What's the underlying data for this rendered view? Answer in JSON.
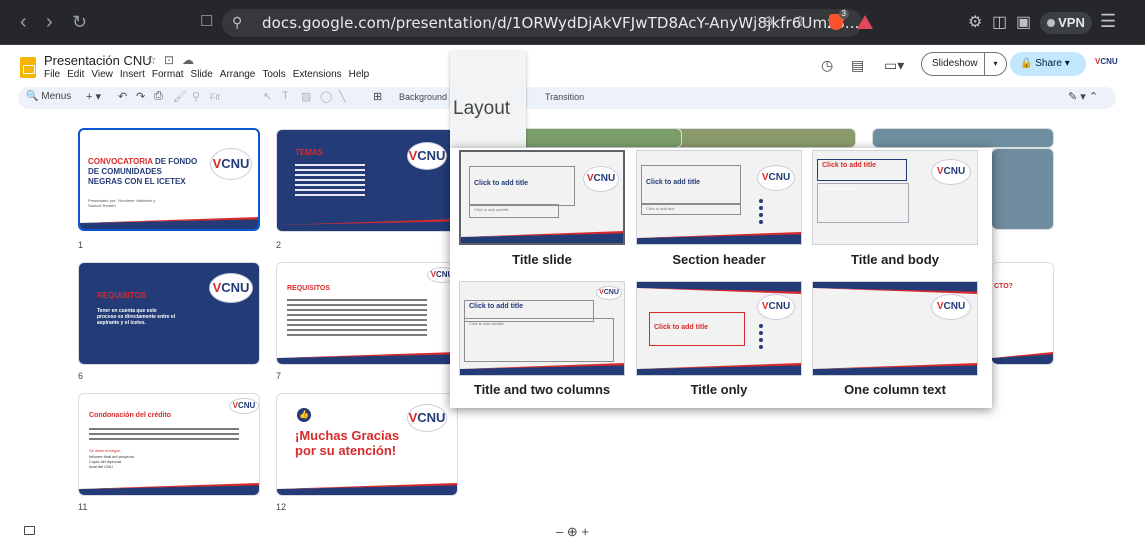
{
  "browser": {
    "url": "docs.google.com/presentation/d/1ORWydDjAkVFJwTD8AcY-AnyWj8jkfr6Umz8...",
    "vpn_label": "VPN",
    "brave_badge": "3"
  },
  "doc": {
    "title": "Presentación CNU",
    "menus": [
      "File",
      "Edit",
      "View",
      "Insert",
      "Format",
      "Slide",
      "Arrange",
      "Tools",
      "Extensions",
      "Help"
    ],
    "slideshow_label": "Slideshow",
    "share_label": "Share",
    "brand_mini": "CNU"
  },
  "toolbar": {
    "menus_label": "Menus",
    "zoom_label": "Fit",
    "background_label": "Background",
    "transition_label": "Transition"
  },
  "slides": [
    {
      "number": "1",
      "title_red": "CONVOCATORIA",
      "title_rest": " DE FONDO DE COMUNIDADES NEGRAS CON EL ICETEX",
      "sub": "Presentado por: Yhonierer Vallesteri y Samuel Renteri"
    },
    {
      "number": "2",
      "title": "TEMAS",
      "items": [
        "Descripción del fondo",
        "¿Qué brinda?",
        "¿A quién está dirigido?",
        "¿Qué financia?",
        "Requisitos",
        "Calendario de la convocatoria",
        "Documentos requeridos"
      ]
    },
    {
      "number": "6",
      "title": "REQUISITOS",
      "body": "Tener en cuenta que este proceso es directamente entre el aspirante y el icetex."
    },
    {
      "number": "7",
      "title": "Requisitos"
    },
    {
      "number": "11",
      "title": "Condonación del crédito",
      "subhead": "Se debe entregar:",
      "items": [
        "Informe final del proyecto",
        "Copia del diploma",
        "Aval del CNU"
      ]
    },
    {
      "number": "12",
      "title": "¡Muchas Gracias por su atención!"
    }
  ],
  "logo_text": "CNU",
  "layout_popup": {
    "tab_label": "Layout",
    "layouts": [
      {
        "label": "Title slide",
        "placeholder": "Click to add title",
        "subtitle": "Click to add subtitle"
      },
      {
        "label": "Section header",
        "placeholder": "Click to add title",
        "subtitle": "Click to add text"
      },
      {
        "label": "Title and body",
        "placeholder": "Click to add title",
        "subtitle": "Click to add subtitle"
      },
      {
        "label": "Title and two columns",
        "placeholder": "Click to add title",
        "subtitle": "Click to add subtitle"
      },
      {
        "label": "Title only",
        "placeholder": "Click to add title"
      },
      {
        "label": "One column text"
      }
    ]
  },
  "partial_slide_text": "CTO?",
  "zoom_controls": "– ⊕ +"
}
